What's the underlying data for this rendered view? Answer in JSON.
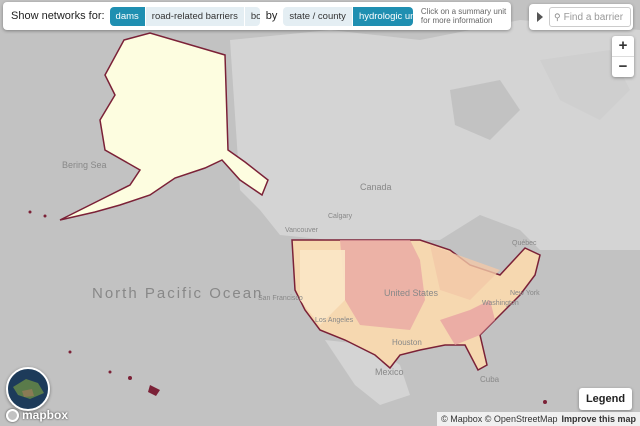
{
  "toolbar": {
    "show_label": "Show networks for:",
    "barrier_types": [
      "dams",
      "road-related barriers",
      "both"
    ],
    "active_barrier_type": "dams",
    "by_label": "by",
    "unit_types": [
      "state / county",
      "hydrologic unit"
    ],
    "active_unit_type": "hydrologic unit",
    "hint": "Click on a summary unit for more information"
  },
  "search": {
    "placeholder": "Find a barrier"
  },
  "zoom": {
    "in": "+",
    "out": "−"
  },
  "legend_button": "Legend",
  "map_labels": {
    "bering_sea": "Bering Sea",
    "canada": "Canada",
    "north_pacific": "North Pacific Ocean",
    "united_states": "United States",
    "mexico": "Mexico",
    "cuba": "Cuba",
    "vancouver": "Vancouver",
    "calgary": "Calgary",
    "san_francisco": "San Francisco",
    "los_angeles": "Los Angeles",
    "houston": "Houston",
    "washington": "Washington",
    "new_york": "New York",
    "quebec": "Québec"
  },
  "attribution": {
    "mapbox": "© Mapbox",
    "osm": "© OpenStreetMap",
    "improve": "Improve this map"
  },
  "logo": "mapbox",
  "colors": {
    "accent": "#1f8fb1",
    "boundary": "#7b2137",
    "alaska_fill": "#fdfde0"
  }
}
